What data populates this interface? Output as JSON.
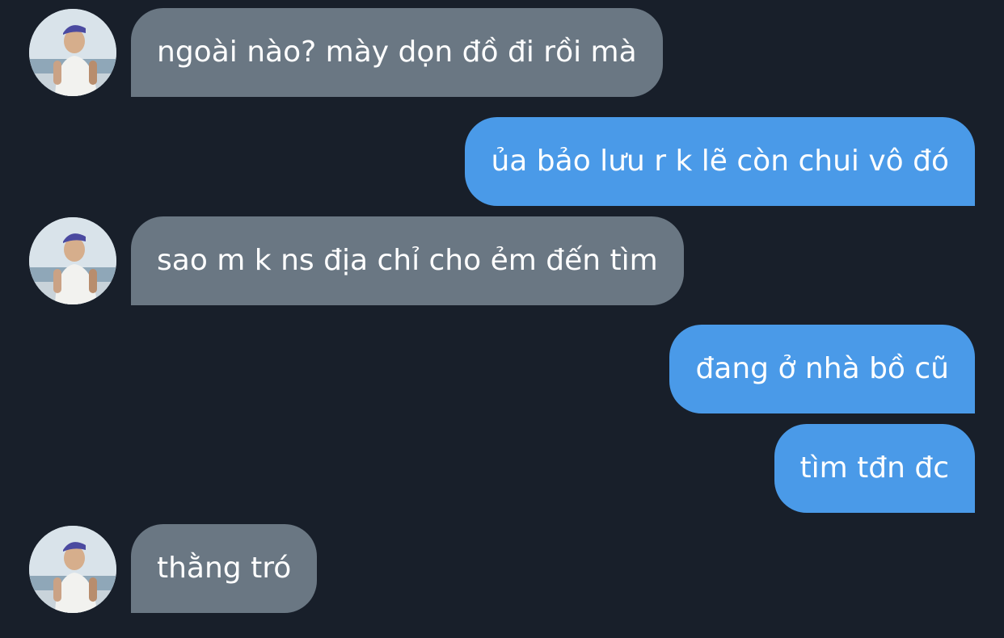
{
  "messages": [
    {
      "direction": "in",
      "text": "ngoài nào? mày dọn đồ đi rồi mà"
    },
    {
      "direction": "out",
      "text": "ủa bảo lưu r k lẽ còn chui vô đó"
    },
    {
      "direction": "in",
      "text": "sao m k ns địa chỉ cho ẻm đến tìm"
    },
    {
      "direction": "out",
      "text": "đang ở nhà bồ cũ"
    },
    {
      "direction": "out",
      "text": "tìm tđn đc"
    },
    {
      "direction": "in",
      "text": "thằng tró"
    }
  ],
  "colors": {
    "background": "#181f2a",
    "incoming_bubble": "#6a7783",
    "outgoing_bubble": "#4a9ae8",
    "text": "#ffffff"
  }
}
